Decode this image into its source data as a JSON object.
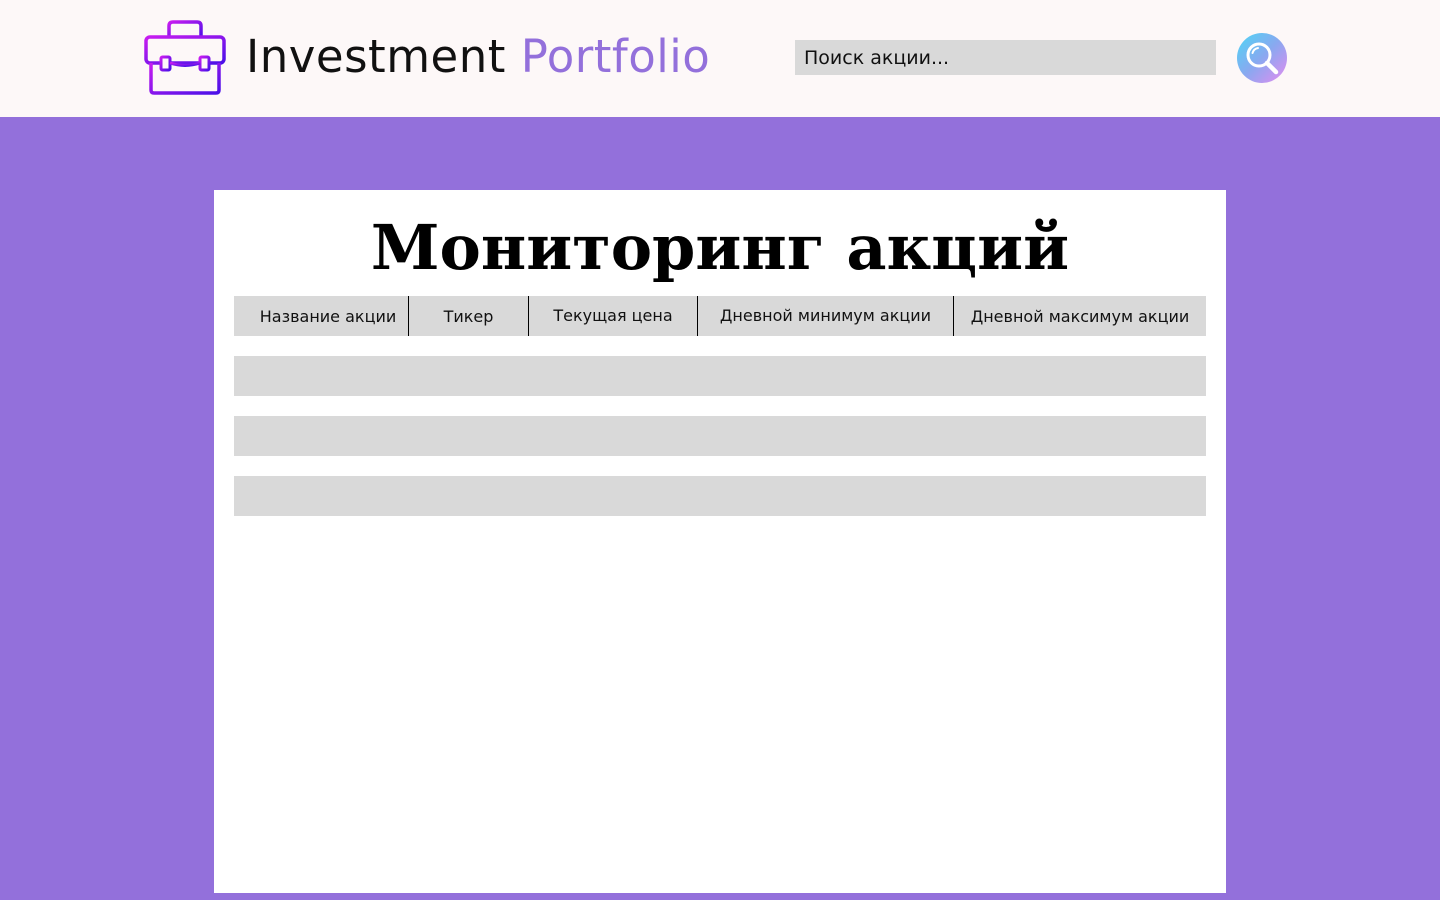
{
  "header": {
    "logo_icon": "briefcase-icon",
    "brand_main": "Investment ",
    "brand_accent": "Portfolio",
    "search_placeholder": "Поиск акции...",
    "search_icon": "search-icon"
  },
  "main": {
    "title": "Мониторинг акций",
    "table": {
      "columns": [
        "Название акции",
        "Тикер",
        "Текущая цена",
        "Дневной минимум акции",
        "Дневной максимум акции"
      ],
      "rows": [
        [],
        [],
        []
      ]
    }
  },
  "colors": {
    "background": "#9370db",
    "header_background": "#fdf8f8",
    "accent": "#9370db",
    "table_fill": "#d9d9d9",
    "card": "#ffffff"
  }
}
